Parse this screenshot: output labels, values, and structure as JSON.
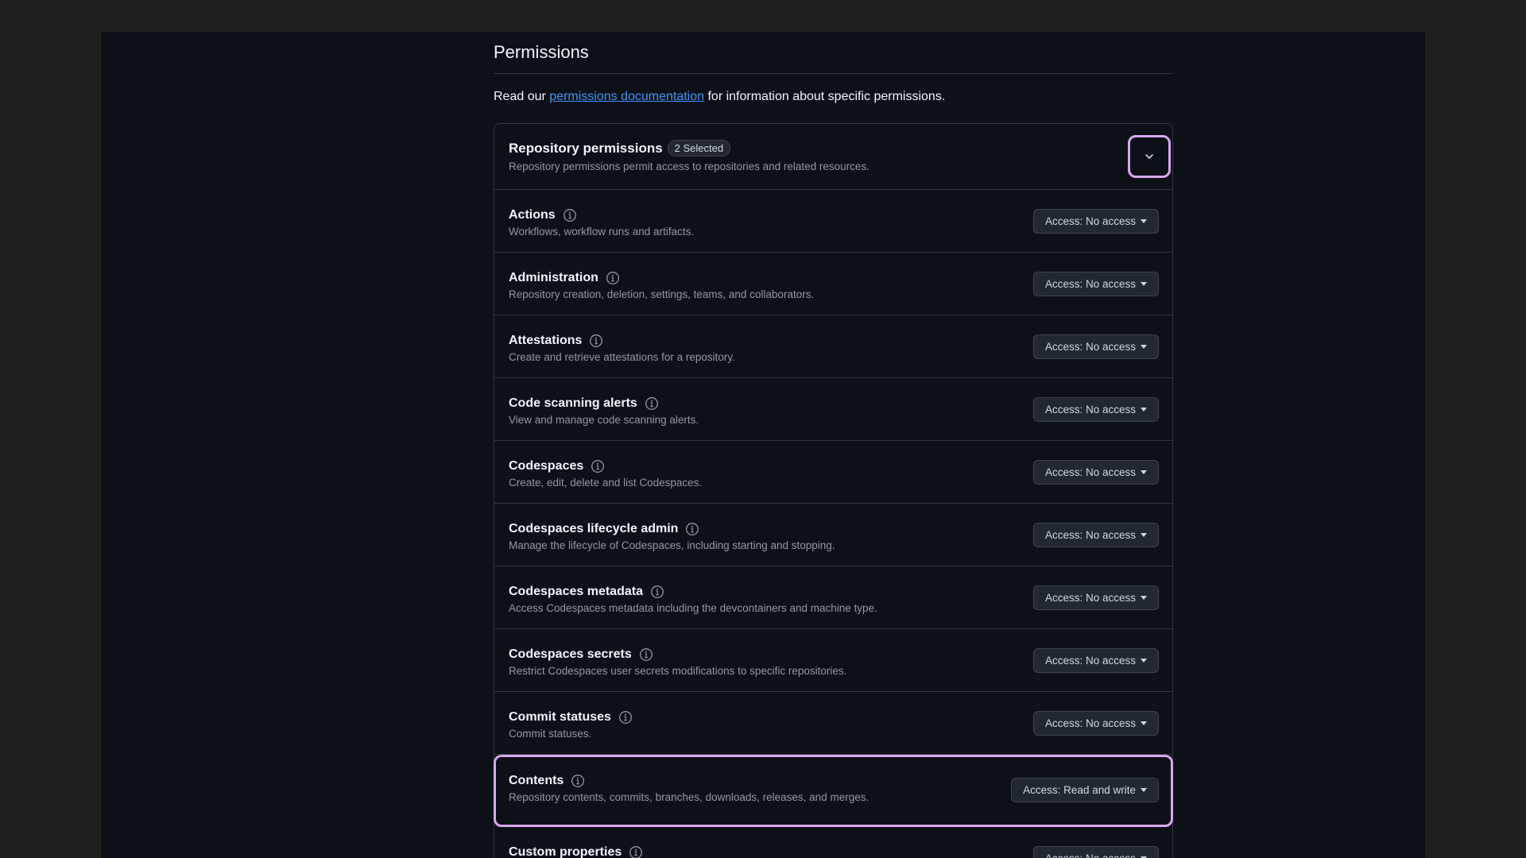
{
  "page": {
    "title": "Permissions",
    "intro_prefix": "Read our ",
    "intro_link": "permissions documentation",
    "intro_suffix": " for information about specific permissions."
  },
  "repository_permissions": {
    "title": "Repository permissions",
    "badge": "2 Selected",
    "description": "Repository permissions permit access to repositories and related resources.",
    "collapse_icon": "chevron-down-icon",
    "items": [
      {
        "name": "Actions",
        "description": "Workflows, workflow runs and artifacts.",
        "access": "Access: No access"
      },
      {
        "name": "Administration",
        "description": "Repository creation, deletion, settings, teams, and collaborators.",
        "access": "Access: No access"
      },
      {
        "name": "Attestations",
        "description": "Create and retrieve attestations for a repository.",
        "access": "Access: No access"
      },
      {
        "name": "Code scanning alerts",
        "description": "View and manage code scanning alerts.",
        "access": "Access: No access"
      },
      {
        "name": "Codespaces",
        "description": "Create, edit, delete and list Codespaces.",
        "access": "Access: No access"
      },
      {
        "name": "Codespaces lifecycle admin",
        "description": "Manage the lifecycle of Codespaces, including starting and stopping.",
        "access": "Access: No access"
      },
      {
        "name": "Codespaces metadata",
        "description": "Access Codespaces metadata including the devcontainers and machine type.",
        "access": "Access: No access"
      },
      {
        "name": "Codespaces secrets",
        "description": "Restrict Codespaces user secrets modifications to specific repositories.",
        "access": "Access: No access"
      },
      {
        "name": "Commit statuses",
        "description": "Commit statuses.",
        "access": "Access: No access"
      },
      {
        "name": "Contents",
        "description": "Repository contents, commits, branches, downloads, releases, and merges.",
        "access": "Access: Read and write",
        "highlighted": true
      },
      {
        "name": "Custom properties",
        "description": "",
        "access": "Access: No access"
      }
    ]
  },
  "colors": {
    "background": "#0d1117",
    "highlight": "#d8a8f0",
    "link": "#4493f8"
  }
}
